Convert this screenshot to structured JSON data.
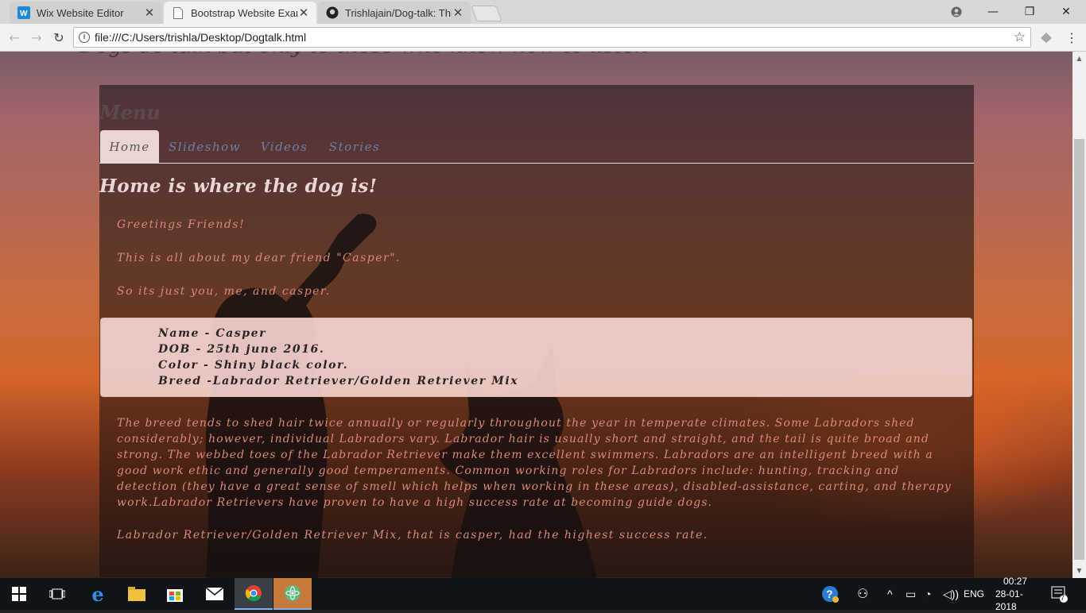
{
  "browser": {
    "tabs": [
      {
        "label": "Wix Website Editor",
        "icon": "wix-icon",
        "active": false
      },
      {
        "label": "Bootstrap Website Examp",
        "icon": "page-icon",
        "active": true
      },
      {
        "label": "Trishlajain/Dog-talk: This",
        "icon": "github-icon",
        "active": false
      }
    ],
    "url": "file:///C:/Users/trishla/Desktop/Dogtalk.html"
  },
  "page": {
    "top_partial_text": "Dogs do talk but only to those who know how to listen",
    "menu_title": "Menu",
    "nav": [
      "Home",
      "Slideshow",
      "Videos",
      "Stories"
    ],
    "active_nav": "Home",
    "heading": "Home is where the dog is!",
    "intro": [
      "Greetings Friends!",
      "This is all about my dear friend \"Casper\".",
      "So its just you, me, and casper."
    ],
    "info": {
      "name": "Name - Casper",
      "dob": "DOB - 25th june 2016.",
      "color": "Color - Shiny black color.",
      "breed": "Breed -Labrador Retriever/Golden Retriever Mix"
    },
    "description": "The breed tends to shed hair twice annually or regularly throughout the year in temperate climates. Some Labradors shed considerably; however, individual Labradors vary. Labrador hair is usually short and straight, and the tail is quite broad and strong. The webbed toes of the Labrador Retriever make them excellent swimmers. Labradors are an intelligent breed with a good work ethic and generally good temperaments. Common working roles for Labradors include: hunting, tracking and detection (they have a great sense of smell which helps when working in these areas), disabled-assistance, carting, and therapy work.Labrador Retrievers have proven to have a high success rate at becoming guide dogs.",
    "closing": "Labrador Retriever/Golden Retriever Mix, that is casper, had the highest success rate."
  },
  "taskbar": {
    "language": "ENG",
    "time": "00:27",
    "date": "28-01-2018",
    "notification_count": "7"
  },
  "colors": {
    "accent_text": "#d98a78",
    "nav_link": "#6f7ea8",
    "info_box": "#f4d2cc"
  }
}
